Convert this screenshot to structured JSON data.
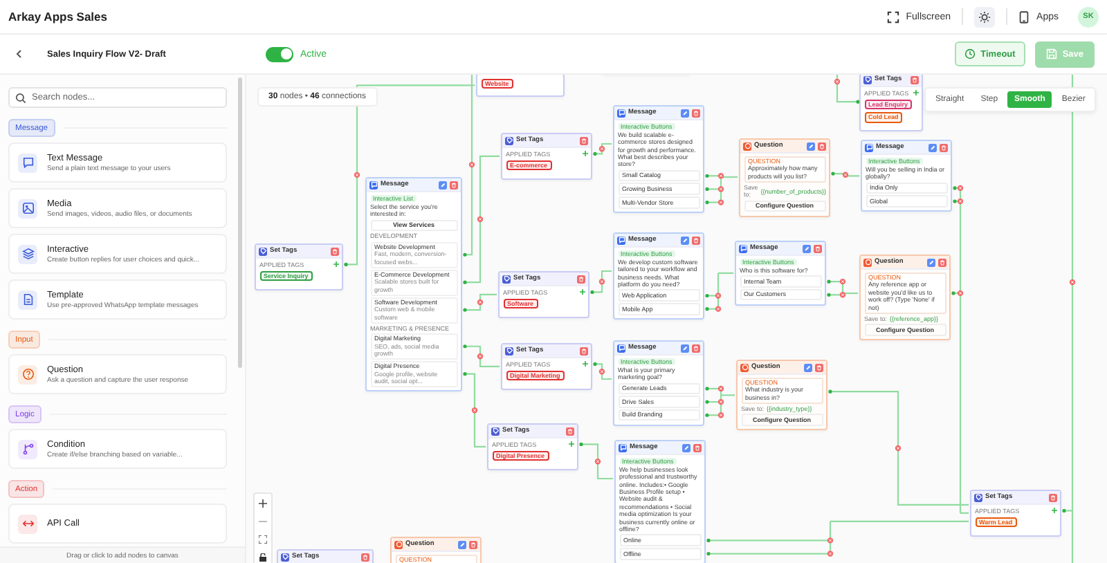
{
  "header": {
    "app_title": "Arkay Apps Sales",
    "fullscreen": "Fullscreen",
    "apps": "Apps",
    "avatar": "SK"
  },
  "toolbar": {
    "flow_title": "Sales Inquiry Flow V2- Draft",
    "active": {
      "on": true,
      "label": "Active"
    },
    "timeout": "Timeout",
    "save": {
      "label": "Save",
      "disabled": true
    }
  },
  "sidebar": {
    "search": {
      "placeholder": "Search nodes..."
    },
    "sections": [
      {
        "title": "Message",
        "color": "#3b5bdb",
        "items": [
          {
            "kind": "text",
            "title": "Text Message",
            "desc": "Send a plain text message to your users"
          },
          {
            "kind": "media",
            "title": "Media",
            "desc": "Send images, videos, audio files, or documents"
          },
          {
            "kind": "interactive",
            "title": "Interactive",
            "desc": "Create button replies for user choices and quick..."
          },
          {
            "kind": "template",
            "title": "Template",
            "desc": "Use pre-approved WhatsApp template messages"
          }
        ]
      },
      {
        "title": "Input",
        "color": "#e8590c",
        "items": [
          {
            "kind": "question",
            "title": "Question",
            "desc": "Ask a question and capture the user response"
          }
        ]
      },
      {
        "title": "Logic",
        "color": "#7c3aed",
        "items": [
          {
            "kind": "condition",
            "title": "Condition",
            "desc": "Create if/else branching based on variable..."
          }
        ]
      },
      {
        "title": "Action",
        "color": "#e03131",
        "items": [
          {
            "kind": "api",
            "title": "API Call"
          }
        ]
      }
    ],
    "footer": "Drag or click to add nodes to canvas"
  },
  "canvas": {
    "stats": "**30** nodes • **46** connections",
    "edge_styles": [
      {
        "label": "Straight",
        "selected": false
      },
      {
        "label": "Step",
        "selected": false
      },
      {
        "label": "Smooth",
        "selected": true
      },
      {
        "label": "Bezier",
        "selected": false
      }
    ],
    "nodes": [
      {
        "kind": "set_tags",
        "title": "Set Tags",
        "label": "APPLIED TAGS",
        "tags": [
          {
            "text": "Service Inquiry",
            "color": "#2f9e44"
          }
        ]
      },
      {
        "kind": "list",
        "title": "Message",
        "badge": "Interactive List",
        "text": "Select the service you're interested in:",
        "button": "View Services",
        "sections": [
          {
            "title": "DEVELOPMENT",
            "items": [
              {
                "title": "Website Development",
                "desc": "Fast, modern, conversion-focused webs..."
              },
              {
                "title": "E-Commerce Development",
                "desc": "Scalable stores built for growth"
              },
              {
                "title": "Software Development",
                "desc": "Custom web & mobile software"
              }
            ]
          },
          {
            "title": "MARKETING & PRESENCE",
            "items": [
              {
                "title": "Digital Marketing",
                "desc": "SEO, ads, social media growth"
              },
              {
                "title": "Digital Presence",
                "desc": "Google profile, website audit, social opt..."
              }
            ]
          }
        ]
      },
      {
        "kind": "set_tags",
        "title": "Set Tags",
        "label": "APPLIED TAGS",
        "tags": [
          {
            "text": "E-commerce",
            "color": "#e03131"
          }
        ]
      },
      {
        "kind": "set_tags",
        "title": "Set Tags",
        "label": "APPLIED TAGS",
        "tags": [
          {
            "text": "Software",
            "color": "#e03131"
          }
        ]
      },
      {
        "kind": "set_tags",
        "title": "Set Tags",
        "label": "APPLIED TAGS",
        "tags": [
          {
            "text": "Digital Marketing",
            "color": "#e03131"
          }
        ]
      },
      {
        "kind": "set_tags",
        "title": "Set Tags",
        "label": "APPLIED TAGS",
        "tags": [
          {
            "text": "Digital Presence",
            "color": "#e03131"
          }
        ]
      },
      {
        "kind": "message",
        "title": "Message",
        "badge": "Interactive Buttons",
        "text": "We build scalable e-commerce stores designed for growth and performance. What best describes your store?",
        "options": [
          "Small Catalog",
          "Growing Business",
          "Multi-Vendor Store"
        ]
      },
      {
        "kind": "question",
        "title": "Question",
        "label": "QUESTION",
        "text": "Approximately how many products will you list?",
        "save_label": "Save to:",
        "variable": "{{number_of_products}}",
        "button": "Configure Question"
      },
      {
        "kind": "message",
        "title": "Message",
        "badge": "Interactive Buttons",
        "text": "We develop custom software tailored to your workflow and business needs. What platform do you need?",
        "options": [
          "Web Application",
          "Mobile App"
        ]
      },
      {
        "kind": "message",
        "title": "Message",
        "badge": "Interactive Buttons",
        "text": "Who is this software for?",
        "options": [
          "Internal Team",
          "Our Customers"
        ]
      },
      {
        "kind": "message",
        "title": "Message",
        "badge": "Interactive Buttons",
        "text": "What is your primary marketing goal?",
        "options": [
          "Generate Leads",
          "Drive Sales",
          "Build Branding"
        ]
      },
      {
        "kind": "question",
        "title": "Question",
        "label": "QUESTION",
        "text": "What industry is your business in?",
        "save_label": "Save to:",
        "variable": "{{industry_type}}",
        "button": "Configure Question"
      },
      {
        "kind": "message",
        "title": "Message",
        "badge": "Interactive Buttons",
        "text": "We help businesses look professional and trustworthy online. Includes:• Google Business Profile setup • Website audit & recommendations • Social media optimization Is your business currently online or offline?",
        "options": [
          "Online",
          "Offline"
        ]
      },
      {
        "kind": "set_tags",
        "title": "Set Tags",
        "label": "APPLIED TAGS",
        "tags": [
          {
            "text": "Lead Enquiry",
            "color": "#d6336c"
          },
          {
            "text": "Cold Lead",
            "color": "#e8590c"
          }
        ]
      },
      {
        "kind": "message",
        "title": "Message",
        "badge": "Interactive Buttons",
        "text": "Will you be selling in India or globally?",
        "options": [
          "India Only",
          "Global"
        ]
      },
      {
        "kind": "question",
        "title": "Question",
        "label": "QUESTION",
        "text": "Any reference app or website you'd like us to work off? (Type 'None' if not)",
        "save_label": "Save to:",
        "variable": "{{reference_app}}",
        "button": "Configure Question"
      },
      {
        "kind": "set_tags",
        "title": "Set Tags",
        "label": "APPLIED TAGS",
        "tags": [
          {
            "text": "Warm Lead",
            "color": "#e8590c"
          }
        ]
      },
      {
        "kind": "set_tags",
        "title": "Set Tags"
      },
      {
        "kind": "question",
        "title": "Question",
        "label": "QUESTION"
      },
      {
        "kind": "partial",
        "tags": [
          {
            "text": "Website",
            "color": "#e03131"
          }
        ]
      },
      {
        "kind": "partial"
      }
    ]
  }
}
